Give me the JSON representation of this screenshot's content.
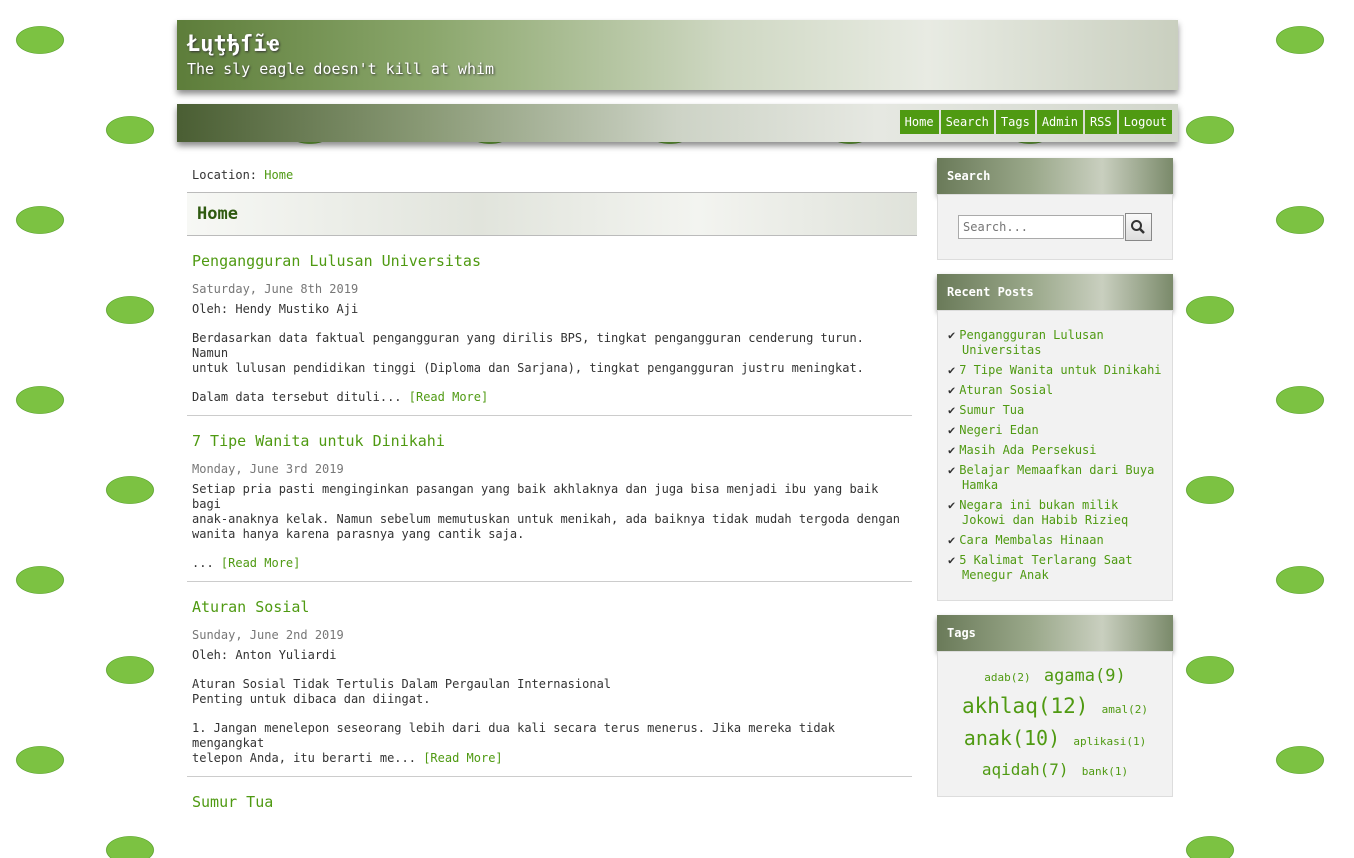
{
  "header": {
    "site_title": "Łųţђſĩҽ",
    "tagline": "The sly eagle doesn't kill at whim"
  },
  "nav": [
    "Home",
    "Search",
    "Tags",
    "Admin",
    "RSS",
    "Logout"
  ],
  "location": {
    "label": "Location:",
    "current": "Home"
  },
  "page_heading": "Home",
  "posts": [
    {
      "title": "Pengangguran Lulusan Universitas",
      "date": "Saturday, June 8th 2019",
      "author": "Oleh: Hendy Mustiko Aji",
      "para1": [
        "Berdasarkan data faktual pengangguran yang dirilis BPS, tingkat pengangguran cenderung turun. Namun",
        "untuk lulusan pendidikan tinggi (Diploma dan Sarjana), tingkat pengangguran justru meningkat."
      ],
      "excerpt": "Dalam data tersebut dituli... ",
      "readmore": "[Read More]"
    },
    {
      "title": "7 Tipe Wanita untuk Dinikahi",
      "date": "Monday, June 3rd 2019",
      "para1": [
        "Setiap pria pasti menginginkan pasangan yang baik akhlaknya dan juga bisa menjadi ibu yang baik bagi",
        "anak-anaknya kelak. Namun sebelum memutuskan untuk menikah, ada baiknya tidak mudah tergoda dengan",
        "wanita hanya karena parasnya yang cantik saja."
      ],
      "excerpt": "... ",
      "readmore": "[Read More]"
    },
    {
      "title": "Aturan Sosial",
      "date": "Sunday, June 2nd 2019",
      "author": "Oleh: Anton Yuliardi",
      "para1": [
        "Aturan Sosial Tidak Tertulis Dalam Pergaulan Internasional",
        "Penting untuk dibaca dan diingat."
      ],
      "para2": "1. Jangan menelepon seseorang lebih dari dua kali secara terus menerus. Jika mereka tidak mengangkat",
      "excerpt": "telepon Anda, itu berarti me... ",
      "readmore": "[Read More]"
    },
    {
      "title": "Sumur Tua"
    }
  ],
  "sidebar": {
    "search_title": "Search",
    "search_placeholder": "Search...",
    "recent_title": "Recent Posts",
    "recent": [
      "Pengangguran Lulusan Universitas",
      "7 Tipe Wanita untuk Dinikahi",
      "Aturan Sosial",
      "Sumur Tua",
      "Negeri Edan",
      "Masih Ada Persekusi",
      "Belajar Memaafkan dari Buya Hamka",
      "Negara ini bukan milik Jokowi dan Habib Rizieq",
      "Cara Membalas Hinaan",
      "5 Kalimat Terlarang Saat Menegur Anak"
    ],
    "tags_title": "Tags",
    "tags": [
      {
        "name": "adab(2)",
        "size": 11
      },
      {
        "name": "agama(9)",
        "size": 17
      },
      {
        "name": "akhlaq(12)",
        "size": 21
      },
      {
        "name": "amal(2)",
        "size": 11
      },
      {
        "name": "anak(10)",
        "size": 20
      },
      {
        "name": "aplikasi(1)",
        "size": 11
      },
      {
        "name": "aqidah(7)",
        "size": 16
      },
      {
        "name": "bank(1)",
        "size": 11
      }
    ]
  }
}
